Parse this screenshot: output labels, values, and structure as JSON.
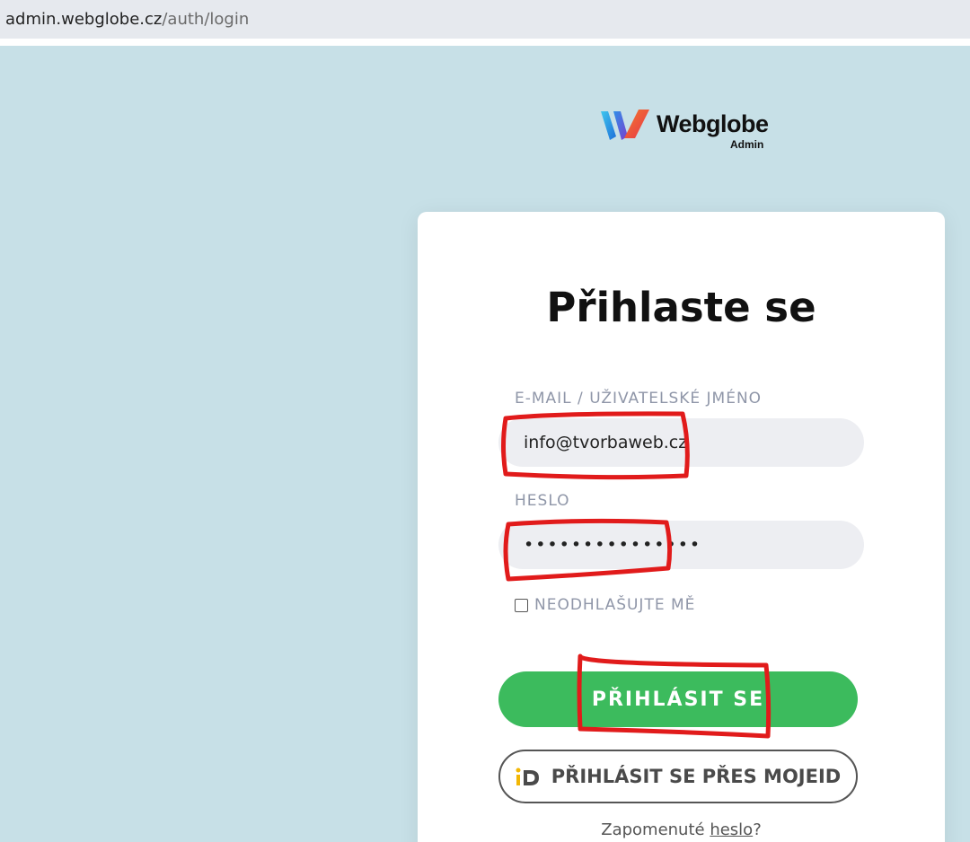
{
  "browser": {
    "url_host": "admin.webglobe.cz",
    "url_path": "/auth/login"
  },
  "logo": {
    "brand": "Webglobe",
    "subtitle": "Admin"
  },
  "login": {
    "title": "Přihlaste se",
    "email_label": "E-MAIL / UŽIVATELSKÉ JMÉNO",
    "email_value": "info@tvorbaweb.cz",
    "password_label": "HESLO",
    "password_value": "•••••••••••••••",
    "remember_label": "NEODHLAŠUJTE MĚ",
    "remember_checked": false,
    "submit_label": "PŘIHLÁSIT SE",
    "mojeid_label": "PŘIHLÁSIT SE PŘES MOJEID",
    "forgot_prefix": "Zapomenuté ",
    "forgot_link": "heslo",
    "forgot_suffix": "?"
  },
  "colors": {
    "page_bg": "#c7e0e7",
    "primary_button": "#3cbb5d",
    "annotation": "#e11b1b"
  }
}
